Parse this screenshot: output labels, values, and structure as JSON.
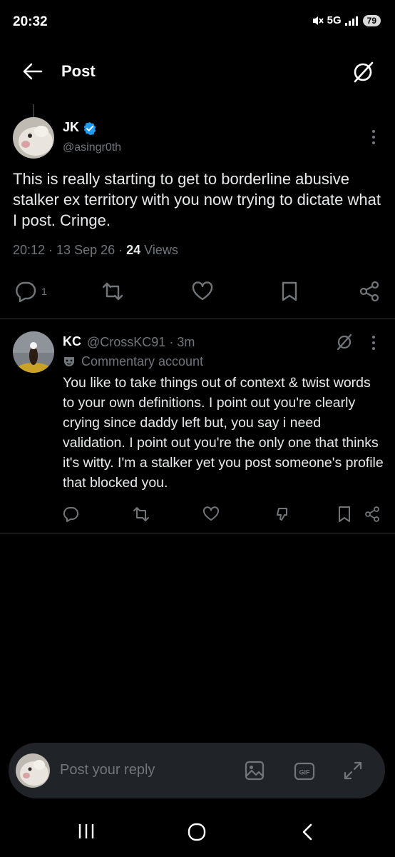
{
  "status_bar": {
    "time": "20:32",
    "network": "5G",
    "battery": "79"
  },
  "header": {
    "title": "Post"
  },
  "post": {
    "author_name": "JK",
    "handle": "@asingr0th",
    "text": "This is really starting to get to borderline abusive stalker ex territory with you now trying to dictate what I post. Cringe.",
    "time": "20:12",
    "date": "13 Sep 26",
    "views_count": "24",
    "views_label": "Views",
    "reply_count": "1"
  },
  "reply": {
    "author_name": "KC",
    "handle": "@CrossKC91",
    "time_ago": "3m",
    "label": "Commentary account",
    "text": "You like to take things out of context & twist words to your own definitions. I point out you're clearly crying since daddy left but, you say i need validation. I point out you're the only one that thinks it's witty. I'm a stalker yet you post someone's profile that blocked you."
  },
  "composer": {
    "placeholder": "Post your reply"
  },
  "colors": {
    "verified": "#1d9bf0",
    "muted": "#71767b",
    "text": "#e7e9ea",
    "background": "#000000"
  }
}
